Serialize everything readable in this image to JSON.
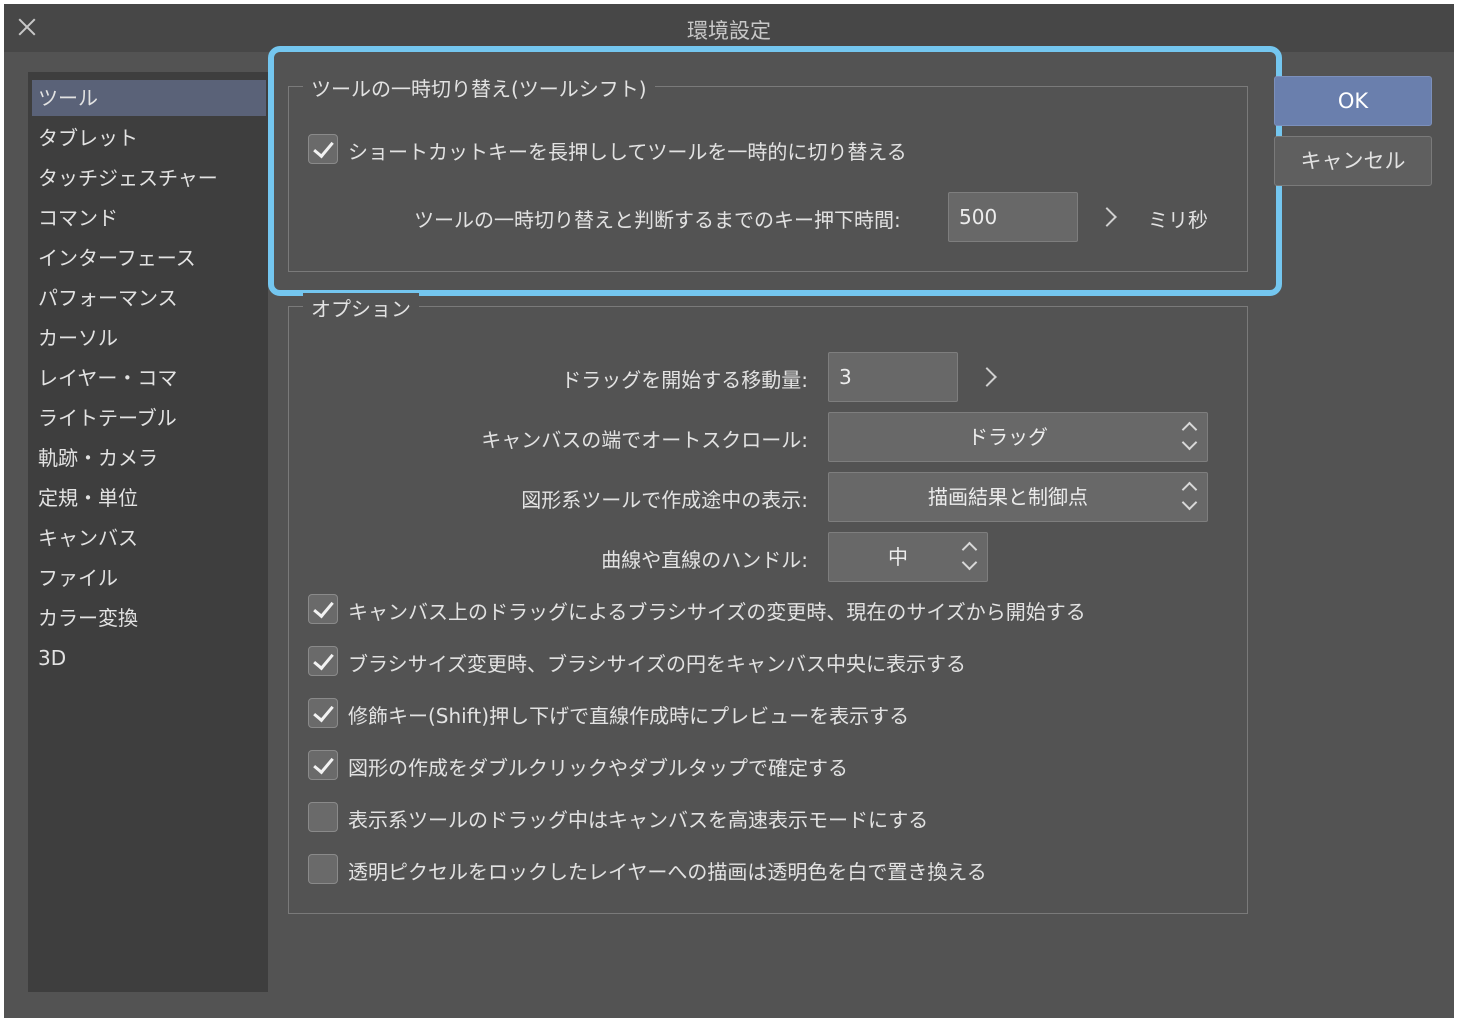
{
  "window": {
    "title": "環境設定"
  },
  "sidebar": {
    "items": [
      {
        "label": "ツール",
        "active": true
      },
      {
        "label": "タブレット"
      },
      {
        "label": "タッチジェスチャー"
      },
      {
        "label": "コマンド"
      },
      {
        "label": "インターフェース"
      },
      {
        "label": "パフォーマンス"
      },
      {
        "label": "カーソル"
      },
      {
        "label": "レイヤー・コマ"
      },
      {
        "label": "ライトテーブル"
      },
      {
        "label": "軌跡・カメラ"
      },
      {
        "label": "定規・単位"
      },
      {
        "label": "キャンバス"
      },
      {
        "label": "ファイル"
      },
      {
        "label": "カラー変換"
      },
      {
        "label": "3D"
      }
    ]
  },
  "tool_shift": {
    "legend": "ツールの一時切り替え(ツールシフト)",
    "long_press_label": "ショートカットキーを長押ししてツールを一時的に切り替える",
    "long_press_checked": true,
    "hold_time_label": "ツールの一時切り替えと判断するまでのキー押下時間:",
    "hold_time_value": "500",
    "hold_time_unit": "ミリ秒"
  },
  "options": {
    "legend": "オプション",
    "drag_start_label": "ドラッグを開始する移動量:",
    "drag_start_value": "3",
    "autoscroll_label": "キャンバスの端でオートスクロール:",
    "autoscroll_value": "ドラッグ",
    "shape_display_label": "図形系ツールで作成途中の表示:",
    "shape_display_value": "描画結果と制御点",
    "handle_label": "曲線や直線のハンドル:",
    "handle_value": "中",
    "checks": [
      {
        "label": "キャンバス上のドラッグによるブラシサイズの変更時、現在のサイズから開始する",
        "checked": true
      },
      {
        "label": "ブラシサイズ変更時、ブラシサイズの円をキャンバス中央に表示する",
        "checked": true
      },
      {
        "label": "修飾キー(Shift)押し下げで直線作成時にプレビューを表示する",
        "checked": true
      },
      {
        "label": "図形の作成をダブルクリックやダブルタップで確定する",
        "checked": true
      },
      {
        "label": "表示系ツールのドラッグ中はキャンバスを高速表示モードにする",
        "checked": false
      },
      {
        "label": "透明ピクセルをロックしたレイヤーへの描画は透明色を白で置き換える",
        "checked": false
      }
    ]
  },
  "buttons": {
    "ok": "OK",
    "cancel": "キャンセル"
  },
  "colors": {
    "accent": "#74c6ef",
    "ok_button": "#6a7fad",
    "panel": "#535353"
  }
}
